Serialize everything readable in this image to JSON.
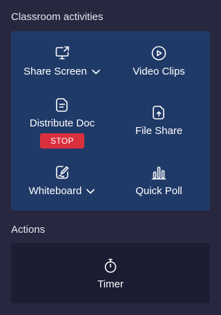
{
  "sections": {
    "classroom_title": "Classroom activities",
    "actions_title": "Actions"
  },
  "activities": {
    "share_screen": {
      "label": "Share Screen",
      "icon": "monitor-share-icon",
      "has_dropdown": true
    },
    "video_clips": {
      "label": "Video Clips",
      "icon": "play-circle-icon"
    },
    "distribute_doc": {
      "label": "Distribute Doc",
      "icon": "document-icon",
      "stop_label": "STOP"
    },
    "file_share": {
      "label": "File Share",
      "icon": "file-upload-icon"
    },
    "whiteboard": {
      "label": "Whiteboard",
      "icon": "pen-board-icon",
      "has_dropdown": true
    },
    "quick_poll": {
      "label": "Quick Poll",
      "icon": "bar-chart-icon"
    }
  },
  "actions": {
    "timer": {
      "label": "Timer",
      "icon": "stopwatch-icon"
    }
  },
  "colors": {
    "background": "#272740",
    "activities_panel": "#203a68",
    "actions_panel": "#1c1c33",
    "stop_button": "#d9303e"
  }
}
